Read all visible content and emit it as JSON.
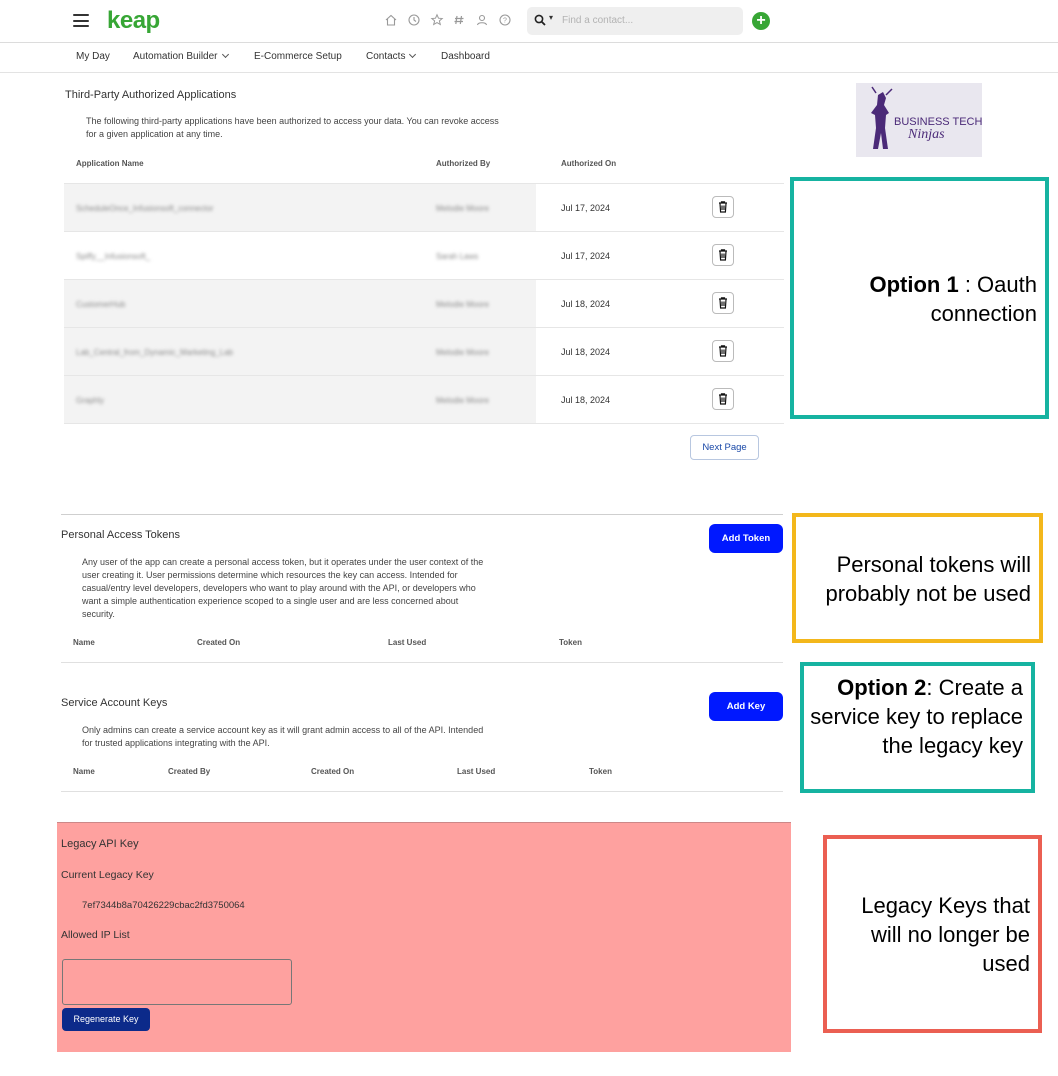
{
  "header": {
    "logo": "keap",
    "search": {
      "placeholder": "Find a contact..."
    },
    "icons": [
      "home-icon",
      "clock-icon",
      "star-icon",
      "hashtag-icon",
      "user-icon",
      "help-icon"
    ],
    "accent": "#37a635"
  },
  "nav": {
    "items": [
      {
        "label": "My Day",
        "dropdown": false
      },
      {
        "label": "Automation Builder",
        "dropdown": true
      },
      {
        "label": "E-Commerce Setup",
        "dropdown": false
      },
      {
        "label": "Contacts",
        "dropdown": true
      },
      {
        "label": "Dashboard",
        "dropdown": false
      }
    ]
  },
  "third_party": {
    "title": "Third-Party Authorized Applications",
    "description": "The following third-party applications have been authorized to access your data. You can revoke access for a given application at any time.",
    "columns": [
      "Application Name",
      "Authorized By",
      "Authorized On"
    ],
    "rows": [
      {
        "app": "ScheduleOnce_Infusionsoft_connector",
        "by": "Melodie Moore",
        "date": "Jul 17, 2024"
      },
      {
        "app": "Spiffy__Infusionsoft_",
        "by": "Sarah Laws",
        "date": "Jul 17, 2024"
      },
      {
        "app": "CustomerHub",
        "by": "Melodie Moore",
        "date": "Jul 18, 2024"
      },
      {
        "app": "Lab_Central_from_Dynamic_Marketing_Lab",
        "by": "Melodie Moore",
        "date": "Jul 18, 2024"
      },
      {
        "app": "Graphly",
        "by": "Melodie Moore",
        "date": "Jul 18, 2024"
      }
    ],
    "next_page_label": "Next Page"
  },
  "personal_tokens": {
    "title": "Personal Access Tokens",
    "button_label": "Add Token",
    "description": "Any user of the app can create a personal access token, but it operates under the user context of the user creating it. User permissions determine which resources the key can access. Intended for casual/entry level developers, developers who want to play around with the API, or developers who want a simple authentication experience scoped to a single user and are less concerned about security.",
    "columns": [
      "Name",
      "Created On",
      "Last Used",
      "Token"
    ]
  },
  "service_keys": {
    "title": "Service Account Keys",
    "button_label": "Add Key",
    "description": "Only admins can create a service account key as it will grant admin access to all of the API. Intended for trusted applications integrating with the API.",
    "columns": [
      "Name",
      "Created By",
      "Created On",
      "Last Used",
      "Token"
    ]
  },
  "legacy": {
    "title": "Legacy API Key",
    "current_label": "Current Legacy Key",
    "key_value": "7ef7344b8a70426229cbac2fd3750064",
    "ip_label": "Allowed IP List",
    "ip_value": "",
    "regenerate_label": "Regenerate Key",
    "highlight_color": "#fea19f"
  },
  "annotations": {
    "option1": {
      "bold": "Option 1",
      "rest": " : Oauth connection",
      "color": "#16b3a1"
    },
    "personal": {
      "text": "Personal tokens will probably not be used",
      "color": "#f3b71b"
    },
    "option2": {
      "bold": "Option 2",
      "rest": ": Create a service key to replace the legacy key",
      "color": "#16b3a1"
    },
    "legacy": {
      "text": "Legacy Keys that will no longer be used",
      "color": "#eb5f52"
    }
  },
  "brand_logo": {
    "line1": "BUSINESS TECH",
    "line2": "Ninjas"
  }
}
